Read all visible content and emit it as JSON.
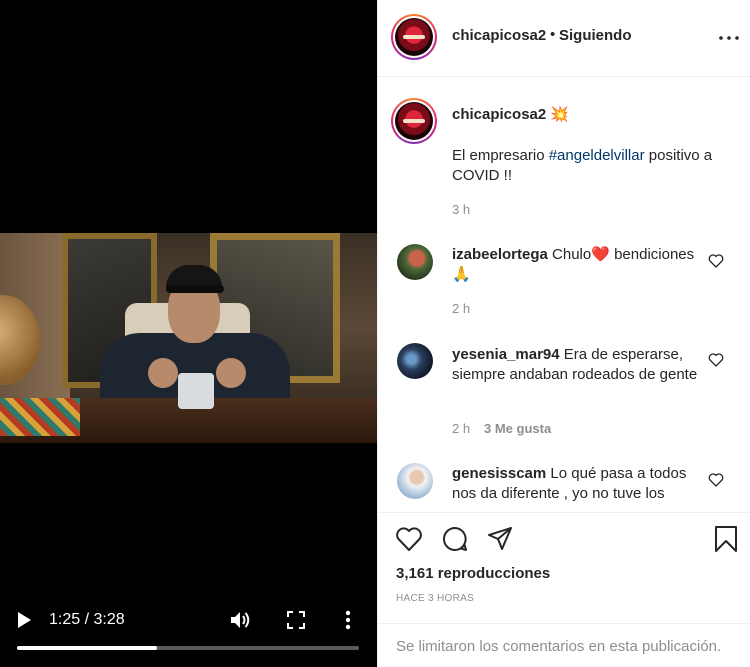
{
  "video": {
    "time": "1:25 / 3:28",
    "progress": 0.41
  },
  "header": {
    "username": "chicapicosa2",
    "dot": "•",
    "follow_status": "Siguiendo"
  },
  "caption": {
    "username": "chicapicosa2",
    "emoji": "💥",
    "text_before": "El empresario ",
    "hashtag": "#angeldelvillar",
    "text_after": " positivo a COVID !!",
    "time": "3 h"
  },
  "comments": [
    {
      "username": "izabeelortega",
      "text": " Chulo❤️ bendiciones 🙏",
      "time": "2 h",
      "likes": ""
    },
    {
      "username": "yesenia_mar94",
      "text": " Era de esperarse, siempre andaban rodeados de gente",
      "time": "2 h",
      "likes": "3 Me gusta"
    },
    {
      "username": "genesisscam",
      "text": " Lo qué pasa a todos nos da diferente , yo no tuve los",
      "time": "",
      "likes": ""
    }
  ],
  "stats": {
    "views": "3,161 reproducciones",
    "posted_ago": "HACE 3 HORAS"
  },
  "footer": {
    "comments_limited": "Se limitaron los comentarios en esta publicación."
  },
  "icons": {
    "play": "play-icon",
    "volume": "volume-icon",
    "fullscreen": "fullscreen-icon",
    "more": "more-vertical-icon",
    "header_more": "more-horizontal-icon",
    "like": "heart-icon",
    "comment": "comment-icon",
    "share": "share-icon",
    "save": "bookmark-icon"
  },
  "colors": {
    "hashtag": "#00376b",
    "muted": "#8e8e8e",
    "text": "#262626",
    "video_bg": "#000000"
  }
}
